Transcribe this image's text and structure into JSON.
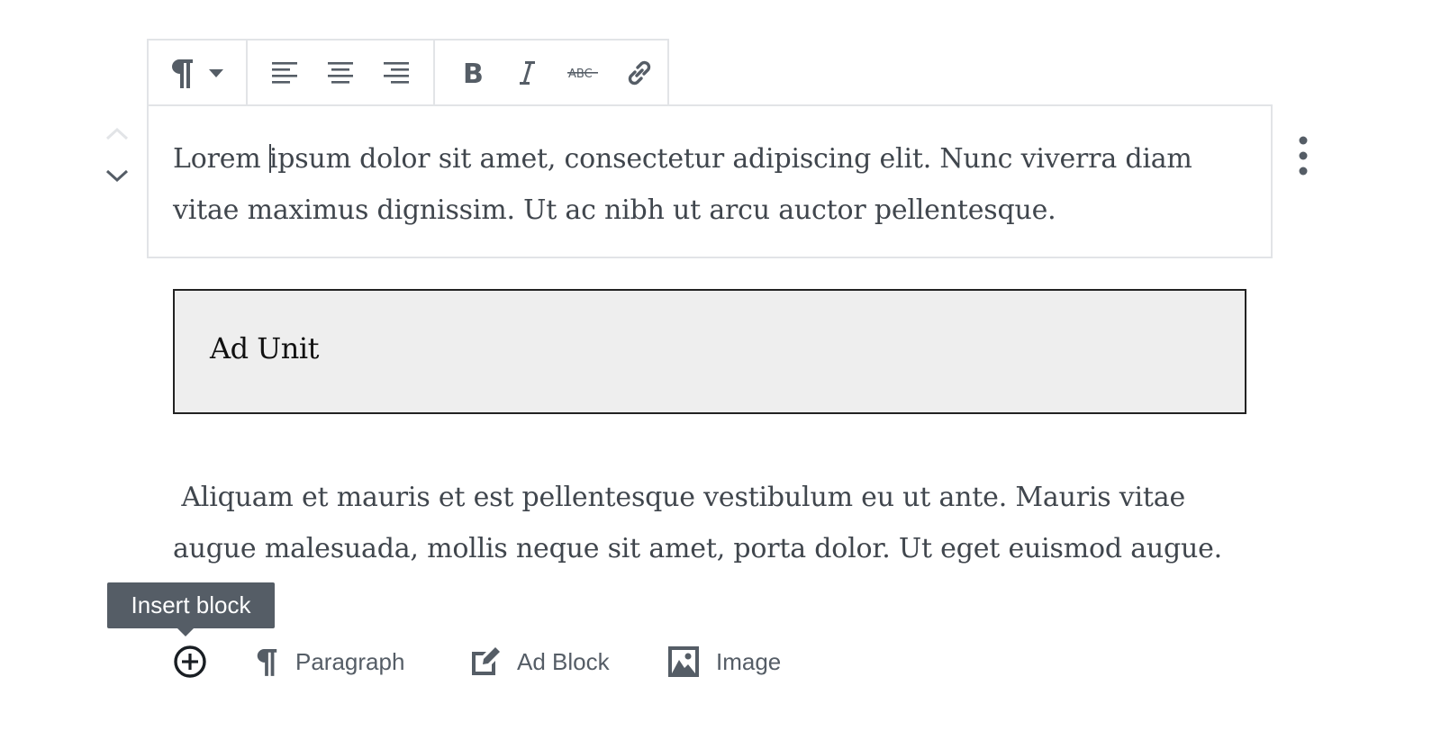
{
  "toolbar": {
    "block_type_icon": "pilcrow-icon",
    "dropdown_icon": "caret-down-icon",
    "align": [
      "align-left-icon",
      "align-center-icon",
      "align-right-icon"
    ],
    "format": [
      "bold-icon",
      "italic-icon",
      "strikethrough-icon",
      "link-icon"
    ],
    "strike_text": "ABC"
  },
  "blocks": {
    "paragraph1": "Lorem ipsum dolor sit amet, consectetur adipiscing elit. Nunc viverra diam vitae maximus dignissim. Ut ac nibh ut arcu auctor pellentesque.",
    "ad_unit_label": "Ad Unit",
    "paragraph2": " Aliquam et mauris et est pellentesque vestibulum eu ut ante. Mauris vitae augue malesuada, mollis neque sit amet, porta dolor. Ut eget euismod augue."
  },
  "inserter": {
    "tooltip": "Insert block",
    "suggestions": [
      {
        "label": "Paragraph",
        "icon": "pilcrow-icon"
      },
      {
        "label": "Ad Block",
        "icon": "edit-icon"
      },
      {
        "label": "Image",
        "icon": "image-icon"
      }
    ]
  },
  "colors": {
    "icon": "#555d66",
    "border": "#e2e4e7",
    "text": "#40464d",
    "ad_background": "#eeeeee"
  }
}
